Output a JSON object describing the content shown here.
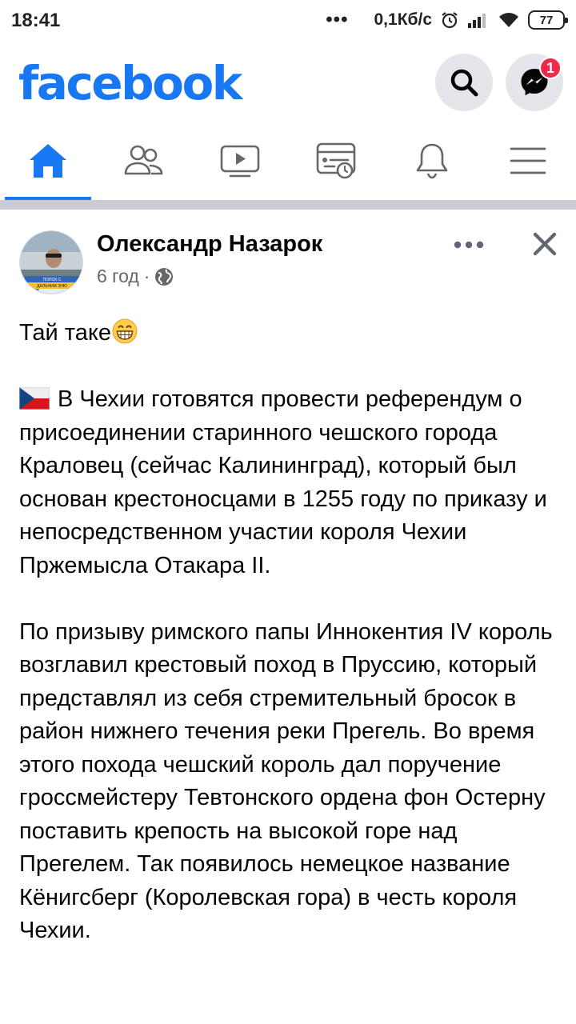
{
  "status_bar": {
    "time": "18:41",
    "dots": "•••",
    "network_speed": "0,1Кб/с",
    "battery_level": "77"
  },
  "header": {
    "logo_text": "facebook",
    "messenger_badge_count": "1",
    "brand_color": "#1877f2"
  },
  "tabs": [
    {
      "name": "home",
      "icon": "home-icon",
      "active": true
    },
    {
      "name": "friends",
      "icon": "friends-icon",
      "active": false
    },
    {
      "name": "watch",
      "icon": "video-icon",
      "active": false
    },
    {
      "name": "news",
      "icon": "news-icon",
      "active": false
    },
    {
      "name": "notifications",
      "icon": "bell-icon",
      "active": false
    },
    {
      "name": "menu",
      "icon": "hamburger-icon",
      "active": false
    }
  ],
  "post": {
    "author": "Олександр Назарок",
    "time": "6 год",
    "meta_separator": "·",
    "audience_icon": "globe-icon",
    "avatar_caption_line1": "ПОРОХ С",
    "avatar_caption_line2": "ДАЛЬНИМ ЗНЮ",
    "intro_text": "Тай таке",
    "intro_emoji": "grinning-face-emoji",
    "paragraph1_flag": "czech-flag-emoji",
    "paragraph1": "В Чехии готовятся провести референдум о присоединении старинного чешского города Краловец (сейчас Калининград), который был основан крестоносцами в 1255 году по приказу и непосредственном участии короля Чехии Пржемысла Отакара II.",
    "paragraph2": "По призыву римского папы Иннокентия IV король возглавил крестовый поход в Пруссию, который представлял из себя стремительный бросок в район нижнего течения реки Прегель. Во время этого похода чешский король дал поручение гроссмейстеру Тевтонского ордена фон Остерну поставить крепость на высокой горе над Прегелем. Так появилось немецкое название Кёнигсберг (Королевская гора) в честь короля Чехии."
  }
}
